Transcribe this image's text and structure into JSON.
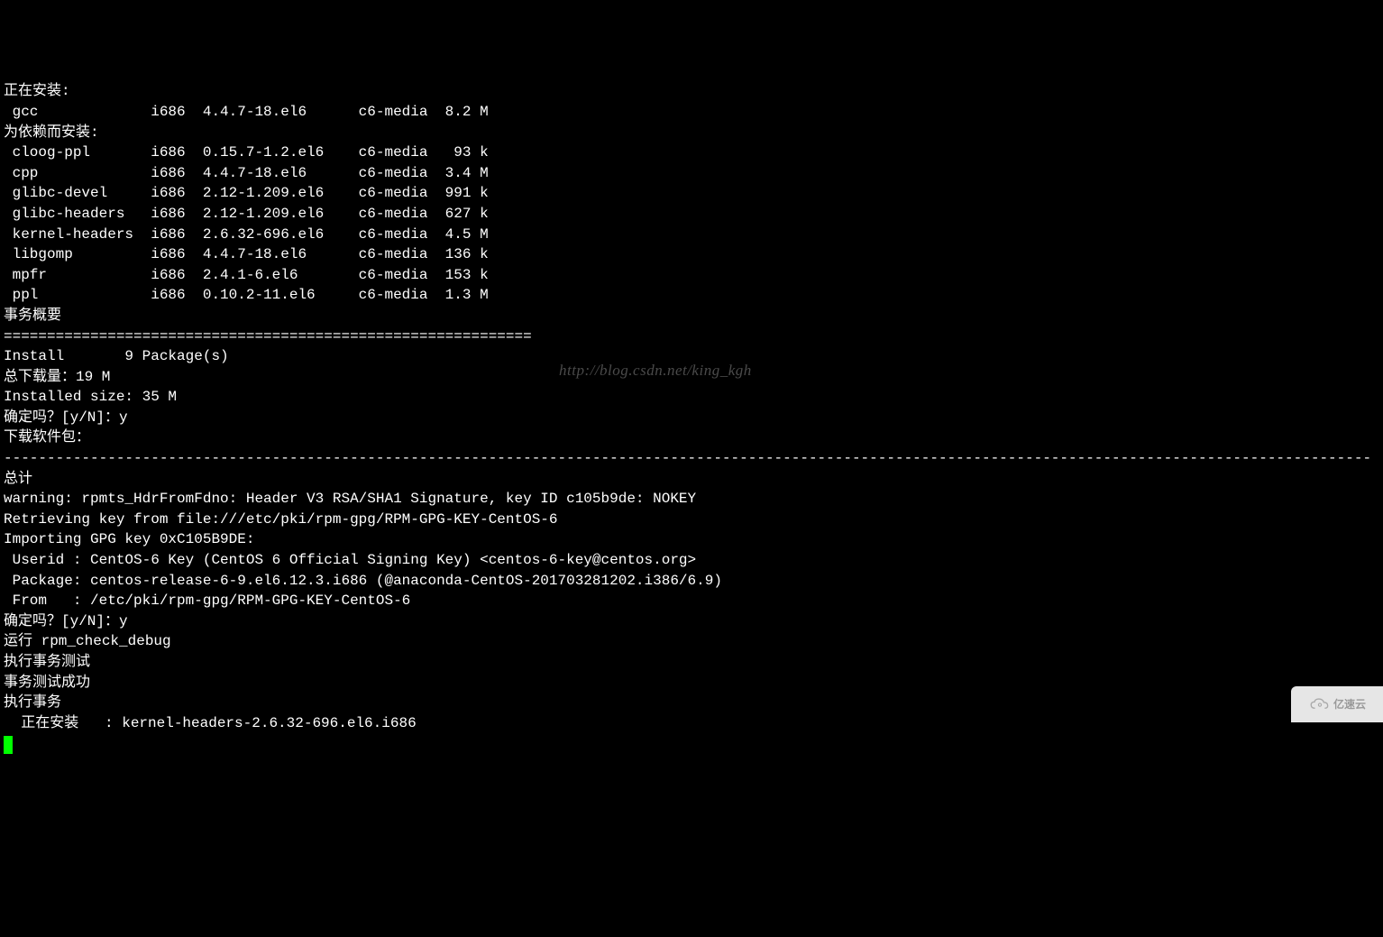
{
  "header": {
    "installing": "正在安装:",
    "dep_install": "为依赖而安装:"
  },
  "packages": {
    "main": [
      {
        "name": "gcc",
        "arch": "i686",
        "version": "4.4.7-18.el6",
        "repo": "c6-media",
        "size": "8.2 M"
      }
    ],
    "deps": [
      {
        "name": "cloog-ppl",
        "arch": "i686",
        "version": "0.15.7-1.2.el6",
        "repo": "c6-media",
        "size": " 93 k"
      },
      {
        "name": "cpp",
        "arch": "i686",
        "version": "4.4.7-18.el6",
        "repo": "c6-media",
        "size": "3.4 M"
      },
      {
        "name": "glibc-devel",
        "arch": "i686",
        "version": "2.12-1.209.el6",
        "repo": "c6-media",
        "size": "991 k"
      },
      {
        "name": "glibc-headers",
        "arch": "i686",
        "version": "2.12-1.209.el6",
        "repo": "c6-media",
        "size": "627 k"
      },
      {
        "name": "kernel-headers",
        "arch": "i686",
        "version": "2.6.32-696.el6",
        "repo": "c6-media",
        "size": "4.5 M"
      },
      {
        "name": "libgomp",
        "arch": "i686",
        "version": "4.4.7-18.el6",
        "repo": "c6-media",
        "size": "136 k"
      },
      {
        "name": "mpfr",
        "arch": "i686",
        "version": "2.4.1-6.el6",
        "repo": "c6-media",
        "size": "153 k"
      },
      {
        "name": "ppl",
        "arch": "i686",
        "version": "0.10.2-11.el6",
        "repo": "c6-media",
        "size": "1.3 M"
      }
    ]
  },
  "summary": {
    "title": "事务概要",
    "divider": "=============================================================",
    "install_line": "Install       9 Package(s)",
    "total_download": "总下载量：19 M",
    "installed_size": "Installed size: 35 M",
    "confirm1": "确定吗？[y/N]：y",
    "downloading": "下载软件包：",
    "dashline": "--------------------------------------------------------------------------------------------------------------------------------------------------------------",
    "total": "总计",
    "warning": "warning: rpmts_HdrFromFdno: Header V3 RSA/SHA1 Signature, key ID c105b9de: NOKEY",
    "retrieve": "Retrieving key from file:///etc/pki/rpm-gpg/RPM-GPG-KEY-CentOS-6",
    "importing": "Importing GPG key 0xC105B9DE:",
    "userid": " Userid : CentOS-6 Key (CentOS 6 Official Signing Key) <centos-6-key@centos.org>",
    "package": " Package: centos-release-6-9.el6.12.3.i686 (@anaconda-CentOS-201703281202.i386/6.9)",
    "from": " From   : /etc/pki/rpm-gpg/RPM-GPG-KEY-CentOS-6",
    "confirm2": "确定吗？[y/N]：y",
    "run_check": "运行 rpm_check_debug",
    "exec_test": "执行事务测试",
    "test_ok": "事务测试成功",
    "exec_trans": "执行事务",
    "installing_pkg": "  正在安装   : kernel-headers-2.6.32-696.el6.i686"
  },
  "watermark": "http://blog.csdn.net/king_kgh",
  "logo_text": "亿速云"
}
